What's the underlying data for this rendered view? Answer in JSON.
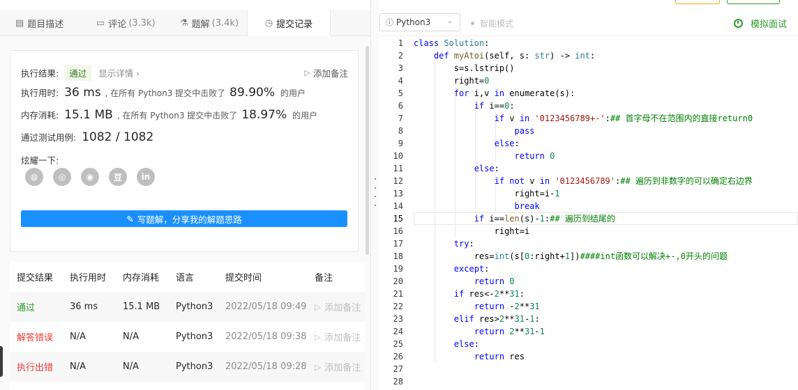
{
  "tabs": [
    {
      "label": "题目描述",
      "count": "",
      "icon": "description-icon",
      "active": false
    },
    {
      "label": "评论",
      "count": "(3.3k)",
      "icon": "comment-icon",
      "active": false
    },
    {
      "label": "题解",
      "count": "(3.4k)",
      "icon": "flask-icon",
      "active": false
    },
    {
      "label": "提交记录",
      "count": "",
      "icon": "clock-icon",
      "active": true
    }
  ],
  "result": {
    "status_label": "执行结果:",
    "status": "通过",
    "detail_link": "显示详情 ›",
    "add_note": "添加备注",
    "time_label": "执行用时:",
    "time_value": "36 ms",
    "time_mid": ", 在所有 Python3 提交中击败了",
    "time_beat": "89.90%",
    "users": "的用户",
    "mem_label": "内存消耗:",
    "mem_value": "15.1 MB",
    "mem_mid": ", 在所有 Python3 提交中击败了",
    "mem_beat": "18.97%",
    "cases_label": "通过测试用例:",
    "cases_value": "1082 / 1082",
    "share_label": "炫耀一下:",
    "share_icons": [
      "wechat-icon",
      "weibo-icon",
      "qq-icon",
      "douban-icon",
      "linkedin-icon"
    ],
    "share_glyphs": [
      "◍",
      "◎",
      "◉",
      "豆",
      "in"
    ],
    "write_button": "写题解，分享我的解题思路"
  },
  "table": {
    "headers": [
      "提交结果",
      "执行用时",
      "内存消耗",
      "语言",
      "提交时间",
      "备注"
    ],
    "rows": [
      {
        "result": "通过",
        "status": "ok",
        "time": "36 ms",
        "mem": "15.1 MB",
        "lang": "Python3",
        "submitted": "2022/05/18 09:49",
        "note": "添加备注"
      },
      {
        "result": "解答错误",
        "status": "err",
        "time": "N/A",
        "mem": "N/A",
        "lang": "Python3",
        "submitted": "2022/05/18 09:38",
        "note": "添加备注"
      },
      {
        "result": "执行出错",
        "status": "err",
        "time": "N/A",
        "mem": "N/A",
        "lang": "Python3",
        "submitted": "2022/05/18 09:28",
        "note": "添加备注"
      }
    ]
  },
  "editor": {
    "language": "Python3",
    "smart_mode": "智能模式",
    "mock_interview": "模拟面试",
    "current_line": 15,
    "lines": [
      [
        [
          "kw",
          "class "
        ],
        [
          "cls",
          "Solution"
        ],
        [
          "",
          ":"
        ]
      ],
      [
        [
          "",
          "    "
        ],
        [
          "kw",
          "def "
        ],
        [
          "fn",
          "myAtoi"
        ],
        [
          "",
          "(self, s: "
        ],
        [
          "ty",
          "str"
        ],
        [
          "",
          ") -> "
        ],
        [
          "ty",
          "int"
        ],
        [
          "",
          ":"
        ]
      ],
      [
        [
          "",
          "        s=s.lstrip()"
        ]
      ],
      [
        [
          "",
          "        right="
        ],
        [
          "num",
          "0"
        ]
      ],
      [
        [
          "",
          "        "
        ],
        [
          "kw",
          "for "
        ],
        [
          "",
          "i,v "
        ],
        [
          "kw",
          "in "
        ],
        [
          "",
          "enumerate(s):"
        ]
      ],
      [
        [
          "",
          "            "
        ],
        [
          "kw",
          "if "
        ],
        [
          "",
          "i=="
        ],
        [
          "num",
          "0"
        ],
        [
          "",
          ":"
        ]
      ],
      [
        [
          "",
          "                "
        ],
        [
          "kw",
          "if "
        ],
        [
          "",
          "v "
        ],
        [
          "kw",
          "in "
        ],
        [
          "str",
          "'0123456789+-'"
        ],
        [
          "",
          ":"
        ],
        [
          "cm",
          "## 首字母不在范围内的直接return0"
        ]
      ],
      [
        [
          "",
          "                    "
        ],
        [
          "kw",
          "pass"
        ]
      ],
      [
        [
          "",
          "                "
        ],
        [
          "kw",
          "else"
        ],
        [
          "",
          ":"
        ]
      ],
      [
        [
          "",
          "                    "
        ],
        [
          "kw",
          "return "
        ],
        [
          "num",
          "0"
        ]
      ],
      [
        [
          "",
          "            "
        ],
        [
          "kw",
          "else"
        ],
        [
          "",
          ":"
        ]
      ],
      [
        [
          "",
          "                "
        ],
        [
          "kw",
          "if not "
        ],
        [
          "",
          "v "
        ],
        [
          "kw",
          "in "
        ],
        [
          "str",
          "'0123456789'"
        ],
        [
          "",
          ":"
        ],
        [
          "cm",
          "## 遍历到非数字的可以确定右边界"
        ]
      ],
      [
        [
          "",
          "                    right=i-"
        ],
        [
          "num",
          "1"
        ]
      ],
      [
        [
          "",
          "                    "
        ],
        [
          "kw",
          "break"
        ]
      ],
      [
        [
          "",
          "            "
        ],
        [
          "kw",
          "if "
        ],
        [
          "",
          "i=="
        ],
        [
          "fn",
          "len"
        ],
        [
          "",
          "(s)-"
        ],
        [
          "num",
          "1"
        ],
        [
          "",
          ":"
        ],
        [
          "cm",
          "## 遍历到结尾的"
        ]
      ],
      [
        [
          "",
          "                right=i"
        ]
      ],
      [
        [
          "",
          "        "
        ],
        [
          "kw",
          "try"
        ],
        [
          "",
          ":"
        ]
      ],
      [
        [
          "",
          "            res="
        ],
        [
          "ty",
          "int"
        ],
        [
          "",
          "(s["
        ],
        [
          "num",
          "0"
        ],
        [
          "",
          ":right+"
        ],
        [
          "num",
          "1"
        ],
        [
          "",
          "])"
        ],
        [
          "cm",
          "####int函数可以解决+-,0开头的问题"
        ]
      ],
      [
        [
          "",
          "        "
        ],
        [
          "kw",
          "except"
        ],
        [
          "",
          ":"
        ]
      ],
      [
        [
          "",
          "            "
        ],
        [
          "kw",
          "return "
        ],
        [
          "num",
          "0"
        ]
      ],
      [
        [
          "",
          "        "
        ],
        [
          "kw",
          "if "
        ],
        [
          "",
          "res<-"
        ],
        [
          "num",
          "2"
        ],
        [
          "",
          "**"
        ],
        [
          "num",
          "31"
        ],
        [
          "",
          ":"
        ]
      ],
      [
        [
          "",
          "            "
        ],
        [
          "kw",
          "return "
        ],
        [
          "",
          "-"
        ],
        [
          "num",
          "2"
        ],
        [
          "",
          "**"
        ],
        [
          "num",
          "31"
        ]
      ],
      [
        [
          "",
          "        "
        ],
        [
          "kw",
          "elif "
        ],
        [
          "",
          "res>"
        ],
        [
          "num",
          "2"
        ],
        [
          "",
          "**"
        ],
        [
          "num",
          "31"
        ],
        [
          "",
          "-"
        ],
        [
          "num",
          "1"
        ],
        [
          "",
          ":"
        ]
      ],
      [
        [
          "",
          "            "
        ],
        [
          "kw",
          "return "
        ],
        [
          "num",
          "2"
        ],
        [
          "",
          "**"
        ],
        [
          "num",
          "31"
        ],
        [
          "",
          "-"
        ],
        [
          "num",
          "1"
        ]
      ],
      [
        [
          "",
          "        "
        ],
        [
          "kw",
          "else"
        ],
        [
          "",
          ":"
        ]
      ],
      [
        [
          "",
          "            "
        ],
        [
          "kw",
          "return "
        ],
        [
          "",
          "res"
        ]
      ],
      [
        [
          "",
          ""
        ]
      ],
      [
        [
          "",
          ""
        ]
      ]
    ]
  }
}
